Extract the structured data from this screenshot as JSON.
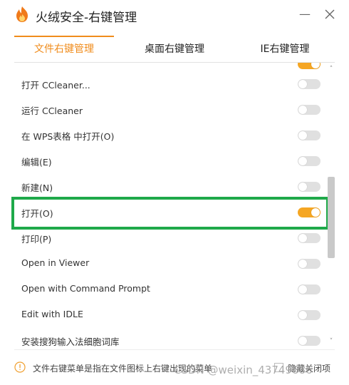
{
  "window": {
    "title": "火绒安全-右键管理",
    "minimize_label": "—",
    "logo_icon": "huorong-flame-icon",
    "close_icon": "close-icon"
  },
  "tabs": [
    {
      "label": "文件右键管理",
      "active": true
    },
    {
      "label": "桌面右键管理",
      "active": false
    },
    {
      "label": "IE右键管理",
      "active": false
    }
  ],
  "items": [
    {
      "label": "打开 CCleaner...",
      "enabled": false
    },
    {
      "label": "运行 CCleaner",
      "enabled": false
    },
    {
      "label": "在 WPS表格 中打开(O)",
      "enabled": false
    },
    {
      "label": "编辑(E)",
      "enabled": false
    },
    {
      "label": "新建(N)",
      "enabled": false
    },
    {
      "label": "打开(O)",
      "enabled": true
    },
    {
      "label": "打印(P)",
      "enabled": false
    },
    {
      "label": "Open in Viewer",
      "enabled": false
    },
    {
      "label": "Open with Command Prompt",
      "enabled": false
    },
    {
      "label": "Edit with IDLE",
      "enabled": false
    },
    {
      "label": "安装搜狗输入法细胞词库",
      "enabled": false
    }
  ],
  "footer": {
    "info_text": "文件右键菜单是指在文件图标上右键出现的菜单",
    "hide_label": "隐藏关闭项"
  },
  "watermark": "CSDN @weixin_43749886",
  "colors": {
    "accent": "#f08c1c",
    "toggle_on": "#f5a623",
    "toggle_off": "#e0e0e0",
    "highlight": "#1fa94a"
  }
}
